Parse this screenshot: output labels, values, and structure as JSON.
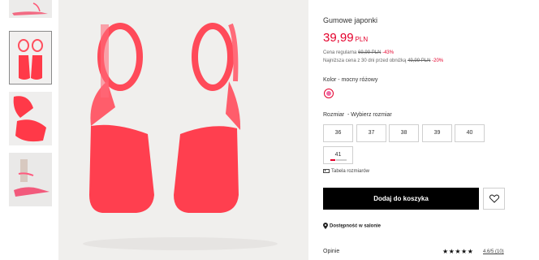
{
  "gallery": {
    "thumbnails": [
      {
        "alt": "sandal-side-view-thumbnail"
      },
      {
        "alt": "sandal-top-view-thumbnail",
        "selected": true
      },
      {
        "alt": "sandal-detail-thumbnail"
      },
      {
        "alt": "sandal-model-thumbnail"
      }
    ],
    "main_image": "pink-jelly-sandals-top-view"
  },
  "product": {
    "title": "Gumowe japonki",
    "price": "39,99",
    "currency": "PLN",
    "regular_label": "Cena regularna",
    "regular_price": "69,99 PLN",
    "regular_discount": "-43%",
    "lowest_label": "Najniższa cena z 30 dni przed obniżką",
    "lowest_price": "49,99 PLN",
    "lowest_discount": "-20%"
  },
  "color": {
    "label": "Kolor",
    "value": "mocny różowy",
    "swatch_color": "#f06aa4",
    "accent": "#e4002b"
  },
  "sizes": {
    "label": "Rozmiar",
    "hint": "Wybierz rozmiar",
    "options": [
      "36",
      "37",
      "38",
      "39",
      "40",
      "41"
    ]
  },
  "size_table": {
    "label": "Tabela rozmiarów",
    "icon": "ruler-icon"
  },
  "actions": {
    "add_to_cart": "Dodaj do koszyka",
    "wishlist_icon": "heart-icon"
  },
  "store": {
    "label": "Dostępność w salonie",
    "icon": "location-pin-icon"
  },
  "reviews": {
    "label": "Opinie",
    "stars": "★★★★★",
    "rating": "4.6/5 (10)"
  }
}
